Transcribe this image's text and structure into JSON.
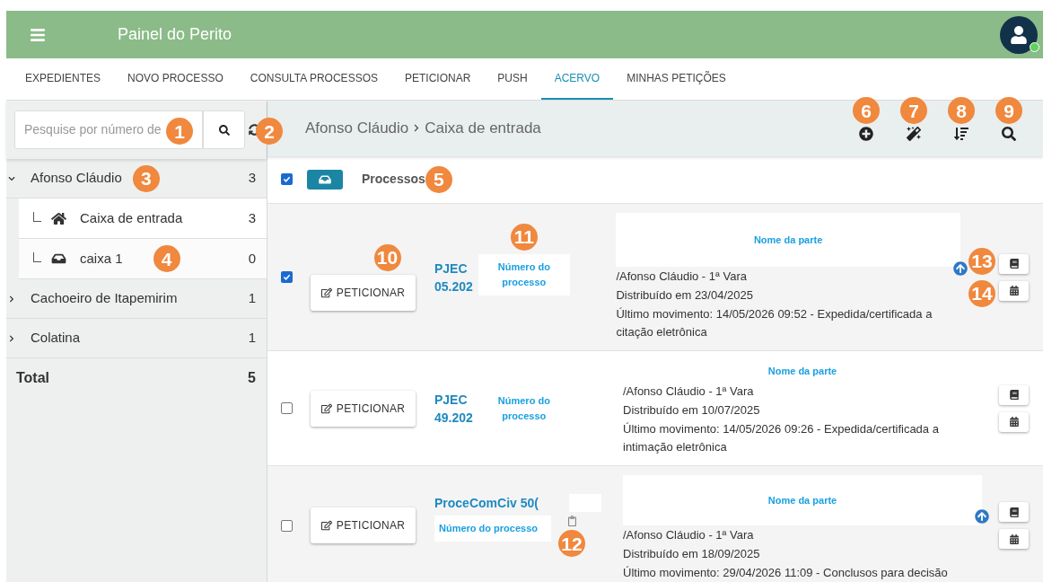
{
  "header": {
    "title": "Painel do Perito",
    "avatar_online": true
  },
  "tabs": [
    {
      "label": "EXPEDIENTES",
      "selected": false
    },
    {
      "label": "NOVO PROCESSO",
      "selected": false
    },
    {
      "label": "CONSULTA PROCESSOS",
      "selected": false
    },
    {
      "label": "PETICIONAR",
      "selected": false
    },
    {
      "label": "PUSH",
      "selected": false
    },
    {
      "label": "ACERVO",
      "selected": true
    },
    {
      "label": "MINHAS PETIÇÕES",
      "selected": false
    }
  ],
  "search": {
    "placeholder": "Pesquise por número de",
    "marker": "1",
    "refresh_marker": "2"
  },
  "sidebar": {
    "items": [
      {
        "label": "Afonso Cláudio",
        "count": "3",
        "expanded": true,
        "marker": "3",
        "children": [
          {
            "label": "Caixa de entrada",
            "count": "3",
            "kind": "home",
            "selected": true
          },
          {
            "label": "caixa 1",
            "count": "0",
            "kind": "inbox",
            "selected": false,
            "marker": "4"
          }
        ]
      },
      {
        "label": "Cachoeiro de Itapemirim",
        "count": "1",
        "expanded": false
      },
      {
        "label": "Colatina",
        "count": "1",
        "expanded": false
      }
    ],
    "total": {
      "label": "Total",
      "count": "5"
    }
  },
  "breadcrumb": [
    "Afonso Cláudio",
    "Caixa de entrada"
  ],
  "toolbar": [
    {
      "kind": "add",
      "marker": "6"
    },
    {
      "kind": "magic",
      "marker": "7"
    },
    {
      "kind": "sort",
      "marker": "8"
    },
    {
      "kind": "search",
      "marker": "9"
    }
  ],
  "list_header": {
    "checked": true,
    "label": "Processos",
    "marker": "5"
  },
  "rows": [
    {
      "checked": true,
      "kind": "side",
      "button": "PETICIONAR",
      "button_marker": "10",
      "class_lines": [
        "PJEC",
        "05.202"
      ],
      "number": "Número do processo",
      "number_marker": "11",
      "party": "Nome da parte",
      "party_box": true,
      "lines": [
        "/Afonso Cláudio - 1ª Vara",
        "Distribuído em 23/04/2025",
        "Último movimento: 14/05/2026 09:52 - Expedida/certificada a citação eletrônica"
      ],
      "arrow": true,
      "book_marker": "13",
      "calendar_marker": "14"
    },
    {
      "checked": false,
      "kind": "side",
      "button": "PETICIONAR",
      "class_lines": [
        "PJEC",
        "49.202"
      ],
      "number": "Número do processo",
      "party": "Nome da parte",
      "party_box": false,
      "lines": [
        "/Afonso Cláudio - 1ª Vara",
        "Distribuído em 10/07/2025",
        "Último movimento: 14/05/2026 09:26 - Expedida/certificada a intimação eletrônica"
      ],
      "arrow": false
    },
    {
      "checked": false,
      "kind": "stacked",
      "button": "PETICIONAR",
      "class_lines": [
        "ProceComCiv 50("
      ],
      "number": "Número do processo",
      "clip_marker": "12",
      "party": "Nome da parte",
      "party_box": true,
      "lines": [
        "/Afonso Cláudio - 1ª Vara",
        "Distribuído em 18/09/2025",
        "Último movimento: 29/04/2026 11:09 - Conclusos para decisão"
      ],
      "arrow": true
    }
  ]
}
